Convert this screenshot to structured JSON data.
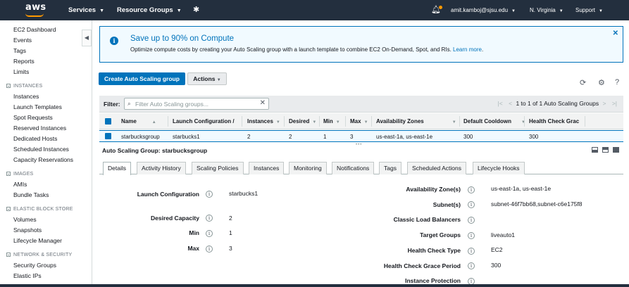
{
  "topbar": {
    "logo": "aws",
    "services": "Services",
    "resource_groups": "Resource Groups",
    "user": "amit.kamboj@sjsu.edu",
    "region": "N. Virginia",
    "support": "Support"
  },
  "sidebar": {
    "top_items": [
      "EC2 Dashboard",
      "Events",
      "Tags",
      "Reports",
      "Limits"
    ],
    "sections": [
      {
        "title": "INSTANCES",
        "items": [
          "Instances",
          "Launch Templates",
          "Spot Requests",
          "Reserved Instances",
          "Dedicated Hosts",
          "Scheduled Instances",
          "Capacity Reservations"
        ]
      },
      {
        "title": "IMAGES",
        "items": [
          "AMIs",
          "Bundle Tasks"
        ]
      },
      {
        "title": "ELASTIC BLOCK STORE",
        "items": [
          "Volumes",
          "Snapshots",
          "Lifecycle Manager"
        ]
      },
      {
        "title": "NETWORK & SECURITY",
        "items": [
          "Security Groups",
          "Elastic IPs"
        ]
      }
    ]
  },
  "banner": {
    "title": "Save up to 90% on Compute",
    "description": "Optimize compute costs by creating your Auto Scaling group with a launch template to combine EC2 On-Demand, Spot, and RIs.",
    "link": "Learn more",
    "link_suffix": "."
  },
  "toolbar": {
    "create_button": "Create Auto Scaling group",
    "actions_button": "Actions"
  },
  "filter": {
    "label": "Filter:",
    "placeholder": "Filter Auto Scaling groups...",
    "pagination": "1 to 1 of 1 Auto Scaling Groups"
  },
  "table": {
    "columns": [
      "Name",
      "Launch Configuration /",
      "Instances",
      "Desired",
      "Min",
      "Max",
      "Availability Zones",
      "Default Cooldown",
      "Health Check Grac"
    ],
    "rows": [
      [
        "starbucksgroup",
        "starbucks1",
        "2",
        "2",
        "1",
        "3",
        "us-east-1a, us-east-1e",
        "300",
        "300"
      ]
    ]
  },
  "details": {
    "title": "Auto Scaling Group: starbucksgroup",
    "tabs": [
      "Details",
      "Activity History",
      "Scaling Policies",
      "Instances",
      "Monitoring",
      "Notifications",
      "Tags",
      "Scheduled Actions",
      "Lifecycle Hooks"
    ],
    "left": [
      {
        "label": "Launch Configuration",
        "value": "starbucks1"
      },
      {
        "label": "Desired Capacity",
        "value": "2"
      },
      {
        "label": "Min",
        "value": "1"
      },
      {
        "label": "Max",
        "value": "3"
      }
    ],
    "right": [
      {
        "label": "Availability Zone(s)",
        "value": "us-east-1a, us-east-1e"
      },
      {
        "label": "Subnet(s)",
        "value": "subnet-46f7bb68,subnet-c6e175f8"
      },
      {
        "label": "Classic Load Balancers",
        "value": ""
      },
      {
        "label": "Target Groups",
        "value": "liveauto1"
      },
      {
        "label": "Health Check Type",
        "value": "EC2"
      },
      {
        "label": "Health Check Grace Period",
        "value": "300"
      },
      {
        "label": "Instance Protection",
        "value": ""
      }
    ]
  },
  "colors": {
    "topbar": "#232f3e",
    "accent": "#0073bb",
    "brand_orange": "#ff9900"
  }
}
